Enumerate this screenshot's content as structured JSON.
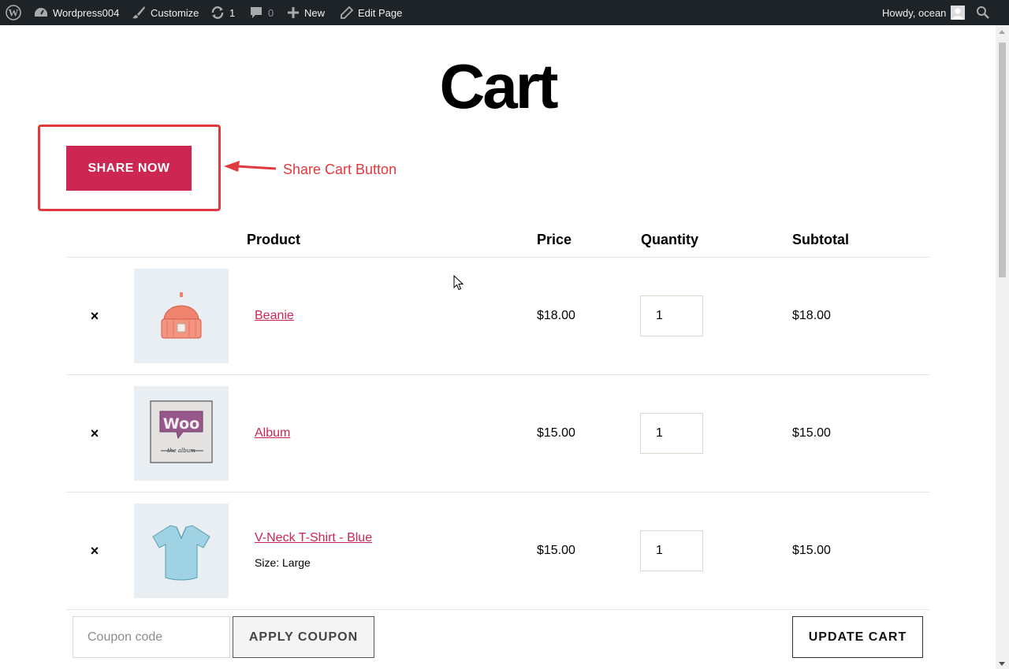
{
  "adminbar": {
    "site_name": "Wordpress004",
    "customize": "Customize",
    "updates_count": "1",
    "comments_count": "0",
    "new_label": "New",
    "edit_page": "Edit Page",
    "greeting": "Howdy, ocean"
  },
  "page": {
    "title": "Cart"
  },
  "annotation": {
    "share_button": "SHARE NOW",
    "label": "Share Cart Button",
    "color": "#e0393e"
  },
  "cart": {
    "headers": {
      "product": "Product",
      "price": "Price",
      "quantity": "Quantity",
      "subtotal": "Subtotal"
    },
    "remove_glyph": "×",
    "items": [
      {
        "name": "Beanie",
        "meta": "",
        "price": "$18.00",
        "quantity": "1",
        "subtotal": "$18.00",
        "image_icon": "beanie-image"
      },
      {
        "name": "Album",
        "meta": "",
        "price": "$15.00",
        "quantity": "1",
        "subtotal": "$15.00",
        "image_icon": "album-image"
      },
      {
        "name": "V-Neck T-Shirt - Blue",
        "meta": "Size: Large",
        "price": "$15.00",
        "quantity": "1",
        "subtotal": "$15.00",
        "image_icon": "tshirt-image"
      }
    ],
    "coupon_placeholder": "Coupon code",
    "apply_coupon": "APPLY COUPON",
    "update_cart": "UPDATE CART"
  },
  "theme": {
    "accent": "#cd2653",
    "adminbar_bg": "#1d2327"
  }
}
